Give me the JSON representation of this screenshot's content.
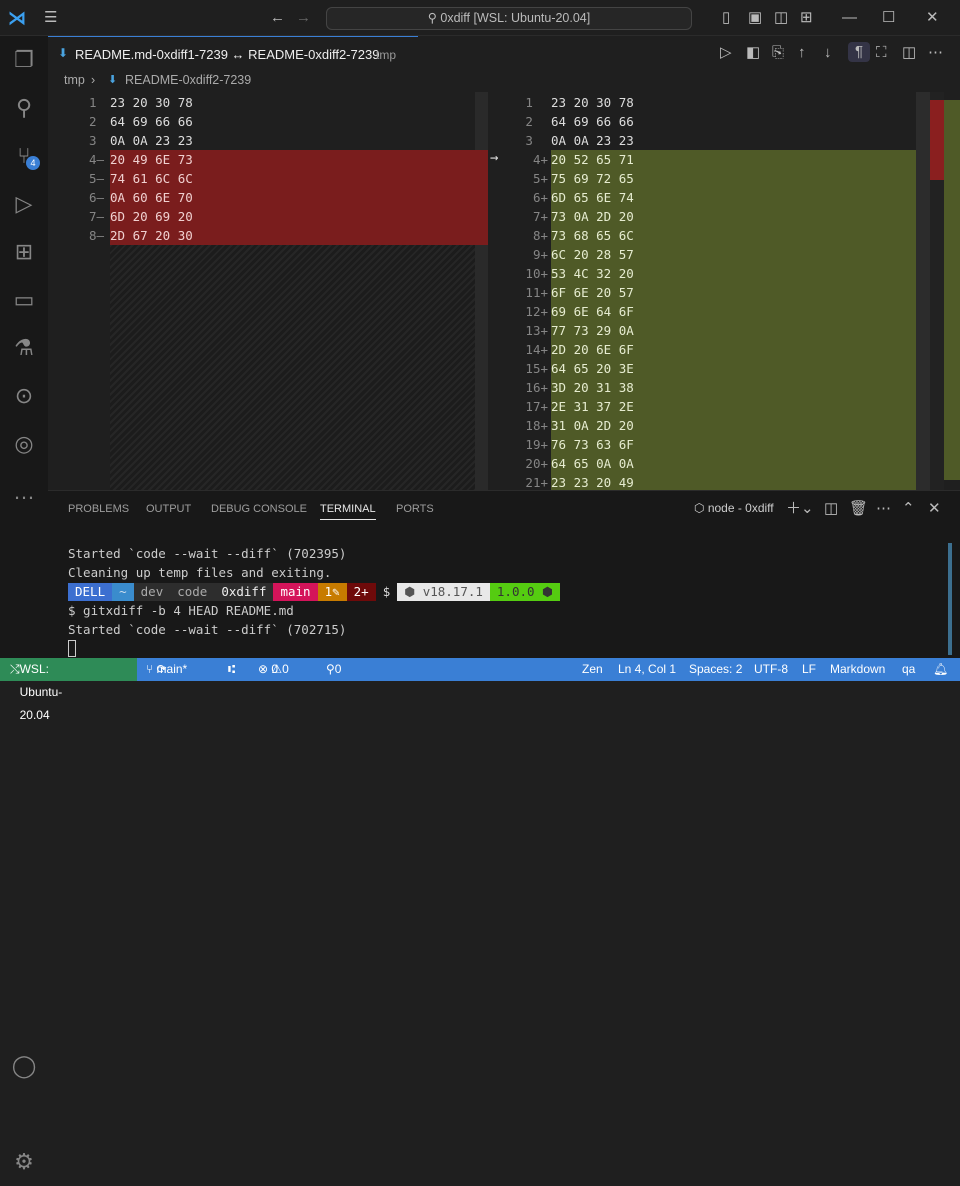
{
  "titlebar": {
    "search": "⚲ 0xdiff [WSL: Ubuntu-20.04]"
  },
  "tab": {
    "title": "README.md-0xdiff1-7239 ↔ README-0xdiff2-7239",
    "desc": "tmp"
  },
  "breadcrumb": {
    "folder": "tmp",
    "file": "README-0xdiff2-7239"
  },
  "left": {
    "lines": [
      "23 20 30 78",
      "64 69 66 66",
      "0A 0A 23 23",
      "20 49 6E 73",
      "74 61 6C 6C",
      "0A 60 6E 70",
      "6D 20 69 20",
      "2D 67 20 30"
    ],
    "removed_from": 4
  },
  "right": {
    "lines": [
      "23 20 30 78",
      "64 69 66 66",
      "0A 0A 23 23",
      "20 52 65 71",
      "75 69 72 65",
      "6D 65 6E 74",
      "73 0A 2D 20",
      "73 68 65 6C",
      "6C 20 28 57",
      "53 4C 32 20",
      "6F 6E 20 57",
      "69 6E 64 6F",
      "77 73 29 0A",
      "2D 20 6E 6F",
      "64 65 20 3E",
      "3D 20 31 38",
      "2E 31 37 2E",
      "31 0A 2D 20",
      "76 73 63 6F",
      "64 65 0A 0A",
      "23 23 20 49"
    ],
    "added_from": 4
  },
  "panel": {
    "tabs": [
      "PROBLEMS",
      "OUTPUT",
      "DEBUG CONSOLE",
      "TERMINAL",
      "PORTS"
    ],
    "active": "TERMINAL",
    "terminal_name": "node - 0xdiff"
  },
  "terminal": {
    "lines": [
      "Started `code --wait --diff` (702395)",
      "Cleaning up temp files and exiting."
    ],
    "prompt": {
      "host": "DELL",
      "home": "~",
      "p1": "dev",
      "p2": "code",
      "p3": "0xdiff",
      "branch": "main",
      "modified": "1✎",
      "added": "2+",
      "dollar": "$",
      "node": "⬢ v18.17.1",
      "pkg": "1.0.0 ⬢"
    },
    "command": "$ gitxdiff -b 4 HEAD README.md",
    "after": "Started `code --wait --diff` (702715)"
  },
  "status": {
    "remote": "WSL: Ubuntu-20.04",
    "branch": "main*",
    "errors": "0",
    "warnings": "0",
    "ports": "0",
    "zen": "Zen",
    "position": "Ln 4, Col 1",
    "spaces": "Spaces: 2",
    "encoding": "UTF-8",
    "eol": "LF",
    "language": "Markdown",
    "profile": "qa"
  },
  "colors": {
    "removed": "#7a1d1d",
    "added": "#4f5a27",
    "status": "#3a7fd5",
    "remote": "#2e8b57"
  }
}
